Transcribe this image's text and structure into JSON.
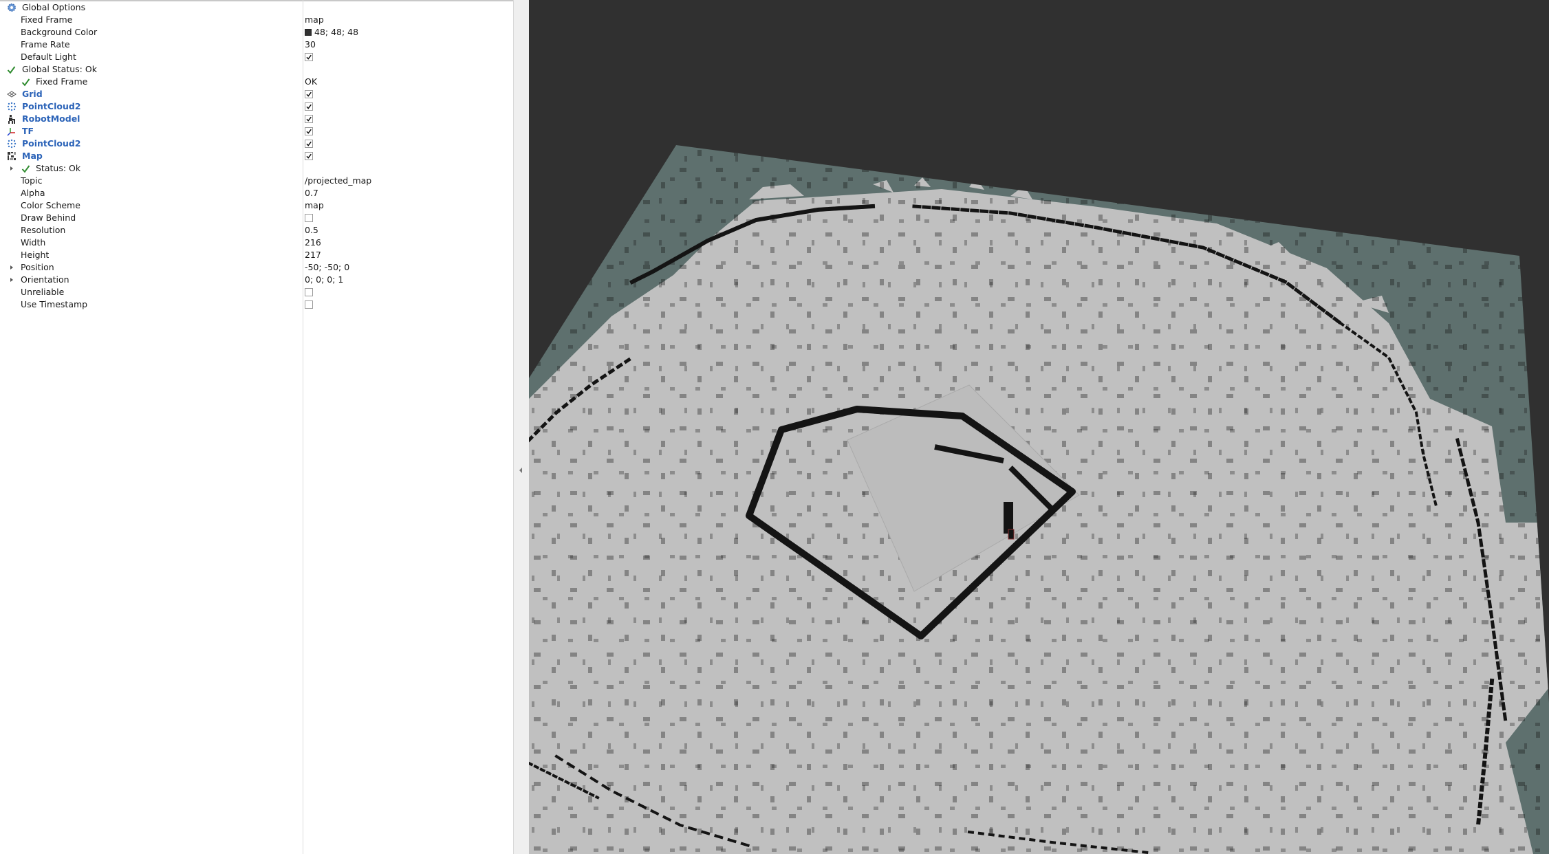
{
  "displays": {
    "rows": [
      {
        "name": "Global Options",
        "value": ""
      },
      {
        "name": "Fixed Frame",
        "value": "map"
      },
      {
        "name": "Background Color",
        "value": "48; 48; 48"
      },
      {
        "name": "Frame Rate",
        "value": "30"
      },
      {
        "name": "Default Light",
        "value": ""
      },
      {
        "name": "Global Status: Ok",
        "value": ""
      },
      {
        "name": "Fixed Frame",
        "value": "OK"
      },
      {
        "name": "Grid",
        "value": ""
      },
      {
        "name": "PointCloud2",
        "value": ""
      },
      {
        "name": "RobotModel",
        "value": ""
      },
      {
        "name": "TF",
        "value": ""
      },
      {
        "name": "PointCloud2",
        "value": ""
      },
      {
        "name": "Map",
        "value": ""
      },
      {
        "name": "Status: Ok",
        "value": ""
      },
      {
        "name": "Topic",
        "value": "/projected_map"
      },
      {
        "name": "Alpha",
        "value": "0.7"
      },
      {
        "name": "Color Scheme",
        "value": "map"
      },
      {
        "name": "Draw Behind",
        "value": ""
      },
      {
        "name": "Resolution",
        "value": "0.5"
      },
      {
        "name": "Width",
        "value": "216"
      },
      {
        "name": "Height",
        "value": "217"
      },
      {
        "name": "Position",
        "value": "-50; -50; 0"
      },
      {
        "name": "Orientation",
        "value": "0; 0; 0; 1"
      },
      {
        "name": "Unreliable",
        "value": ""
      },
      {
        "name": "Use Timestamp",
        "value": ""
      }
    ],
    "checkboxes": {
      "default_light": true,
      "grid": true,
      "pointcloud2_a": true,
      "robotmodel": true,
      "tf": true,
      "pointcloud2_b": true,
      "map": true,
      "draw_behind": false,
      "unreliable": false,
      "use_timestamp": false
    }
  },
  "colors": {
    "background_swatch": "#303030",
    "viewport_background": "#303030",
    "map_unknown": "#5e706e",
    "map_free": "#c0c0c0",
    "map_occupied": "#141414",
    "status_ok": "#2e8b2e",
    "display_name": "#2b63b8"
  },
  "icons": {
    "global_options": "gear-icon",
    "status": "checkmark-icon",
    "grid": "grid-icon",
    "pointcloud2": "pointcloud-icon",
    "robotmodel": "robot-icon",
    "tf": "axes-icon",
    "map": "map-icon",
    "expand": "expand-arrow-icon",
    "splitter": "collapse-arrow-icon"
  }
}
